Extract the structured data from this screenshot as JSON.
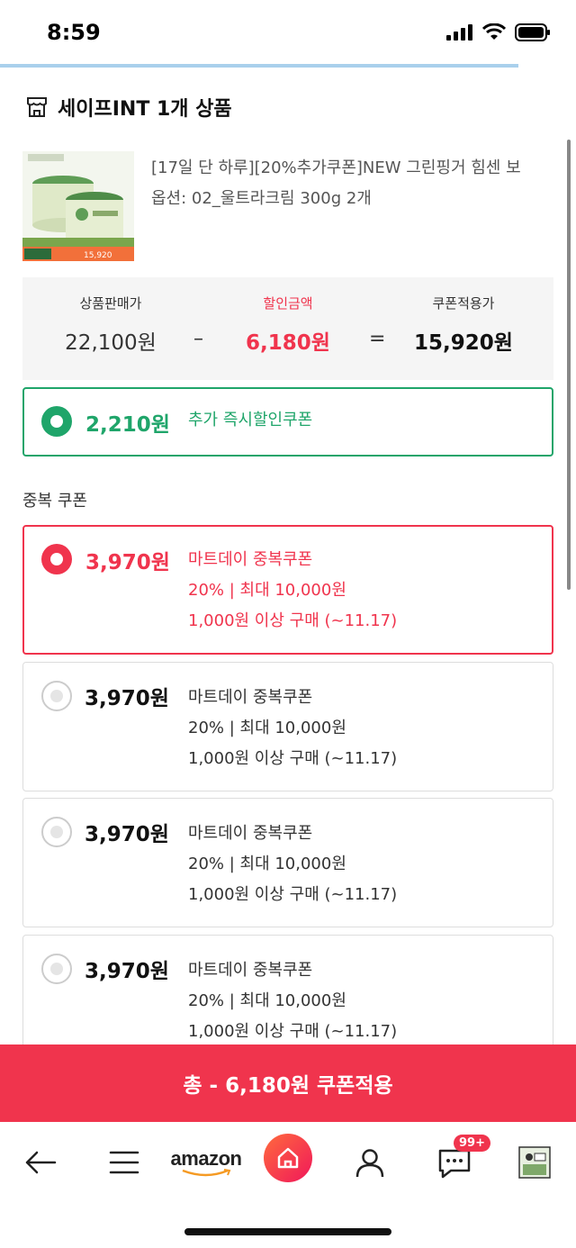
{
  "status": {
    "time": "8:59"
  },
  "store": {
    "title": "세이프INT 1개 상품"
  },
  "product": {
    "name": "[17일 단 하루][20%추가쿠폰]NEW 그린핑거 힘센 보",
    "option": "옵션: 02_울트라크림 300g 2개",
    "thumb_banner": "15,920"
  },
  "price": {
    "sale_label": "상품판매가",
    "sale_value": "22,100원",
    "discount_label": "할인금액",
    "discount_value": "6,180원",
    "final_label": "쿠폰적용가",
    "final_value": "15,920원",
    "minus": "–",
    "equals": "="
  },
  "instant_coupon": {
    "amount": "2,210원",
    "label": "추가 즉시할인쿠폰"
  },
  "duplicate_section": {
    "label": "중복 쿠폰"
  },
  "coupons": [
    {
      "amount": "3,970원",
      "name": "마트데이 중복쿠폰",
      "rate": "20% | 최대 10,000원",
      "cond": "1,000원 이상 구매 (~11.17)",
      "selected": true
    },
    {
      "amount": "3,970원",
      "name": "마트데이 중복쿠폰",
      "rate": "20% | 최대 10,000원",
      "cond": "1,000원 이상 구매 (~11.17)",
      "selected": false
    },
    {
      "amount": "3,970원",
      "name": "마트데이 중복쿠폰",
      "rate": "20% | 최대 10,000원",
      "cond": "1,000원 이상 구매 (~11.17)",
      "selected": false
    },
    {
      "amount": "3,970원",
      "name": "마트데이 중복쿠폰",
      "rate": "20% | 최대 10,000원",
      "cond": "1,000원 이상 구매 (~11.17)",
      "selected": false
    }
  ],
  "apply_button": {
    "label": "총 - 6,180원 쿠폰적용"
  },
  "nav": {
    "amazon": "amazon",
    "chat_badge": "99+"
  },
  "colors": {
    "accent_red": "#f0344d",
    "accent_green": "#1fa56a"
  }
}
